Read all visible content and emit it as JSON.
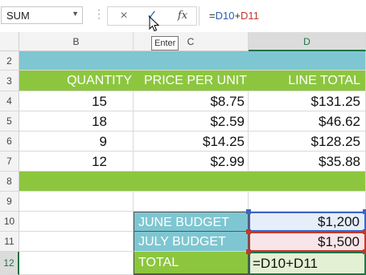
{
  "name_box": {
    "value": "SUM"
  },
  "formula_bar": {
    "cancel_icon": "×",
    "enter_icon": "✓",
    "fx_label": "fx",
    "tooltip": "Enter",
    "formula_prefix": "=",
    "ref1": "D10",
    "op": "+",
    "ref2": "D11"
  },
  "columns": [
    "B",
    "C",
    "D"
  ],
  "rows": [
    "2",
    "3",
    "4",
    "5",
    "6",
    "7",
    "8",
    "9",
    "10",
    "11",
    "12"
  ],
  "table": {
    "headers": [
      "QUANTITY",
      "PRICE PER UNIT",
      "LINE TOTAL"
    ],
    "rows": [
      [
        "15",
        "$8.75",
        "$131.25"
      ],
      [
        "18",
        "$2.59",
        "$46.62"
      ],
      [
        "9",
        "$14.25",
        "$128.25"
      ],
      [
        "12",
        "$2.99",
        "$35.88"
      ]
    ]
  },
  "budget": {
    "june_label": "JUNE BUDGET",
    "june_value": "$1,200",
    "july_label": "JULY BUDGET",
    "july_value": "$1,500",
    "total_label": "TOTAL",
    "total_formula": "=D10+D11"
  },
  "colors": {
    "teal": "#7ec6d1",
    "green": "#8cc63e",
    "excel_green": "#217346",
    "ref_blue": "#3a66c4",
    "ref_red": "#c0392b"
  }
}
